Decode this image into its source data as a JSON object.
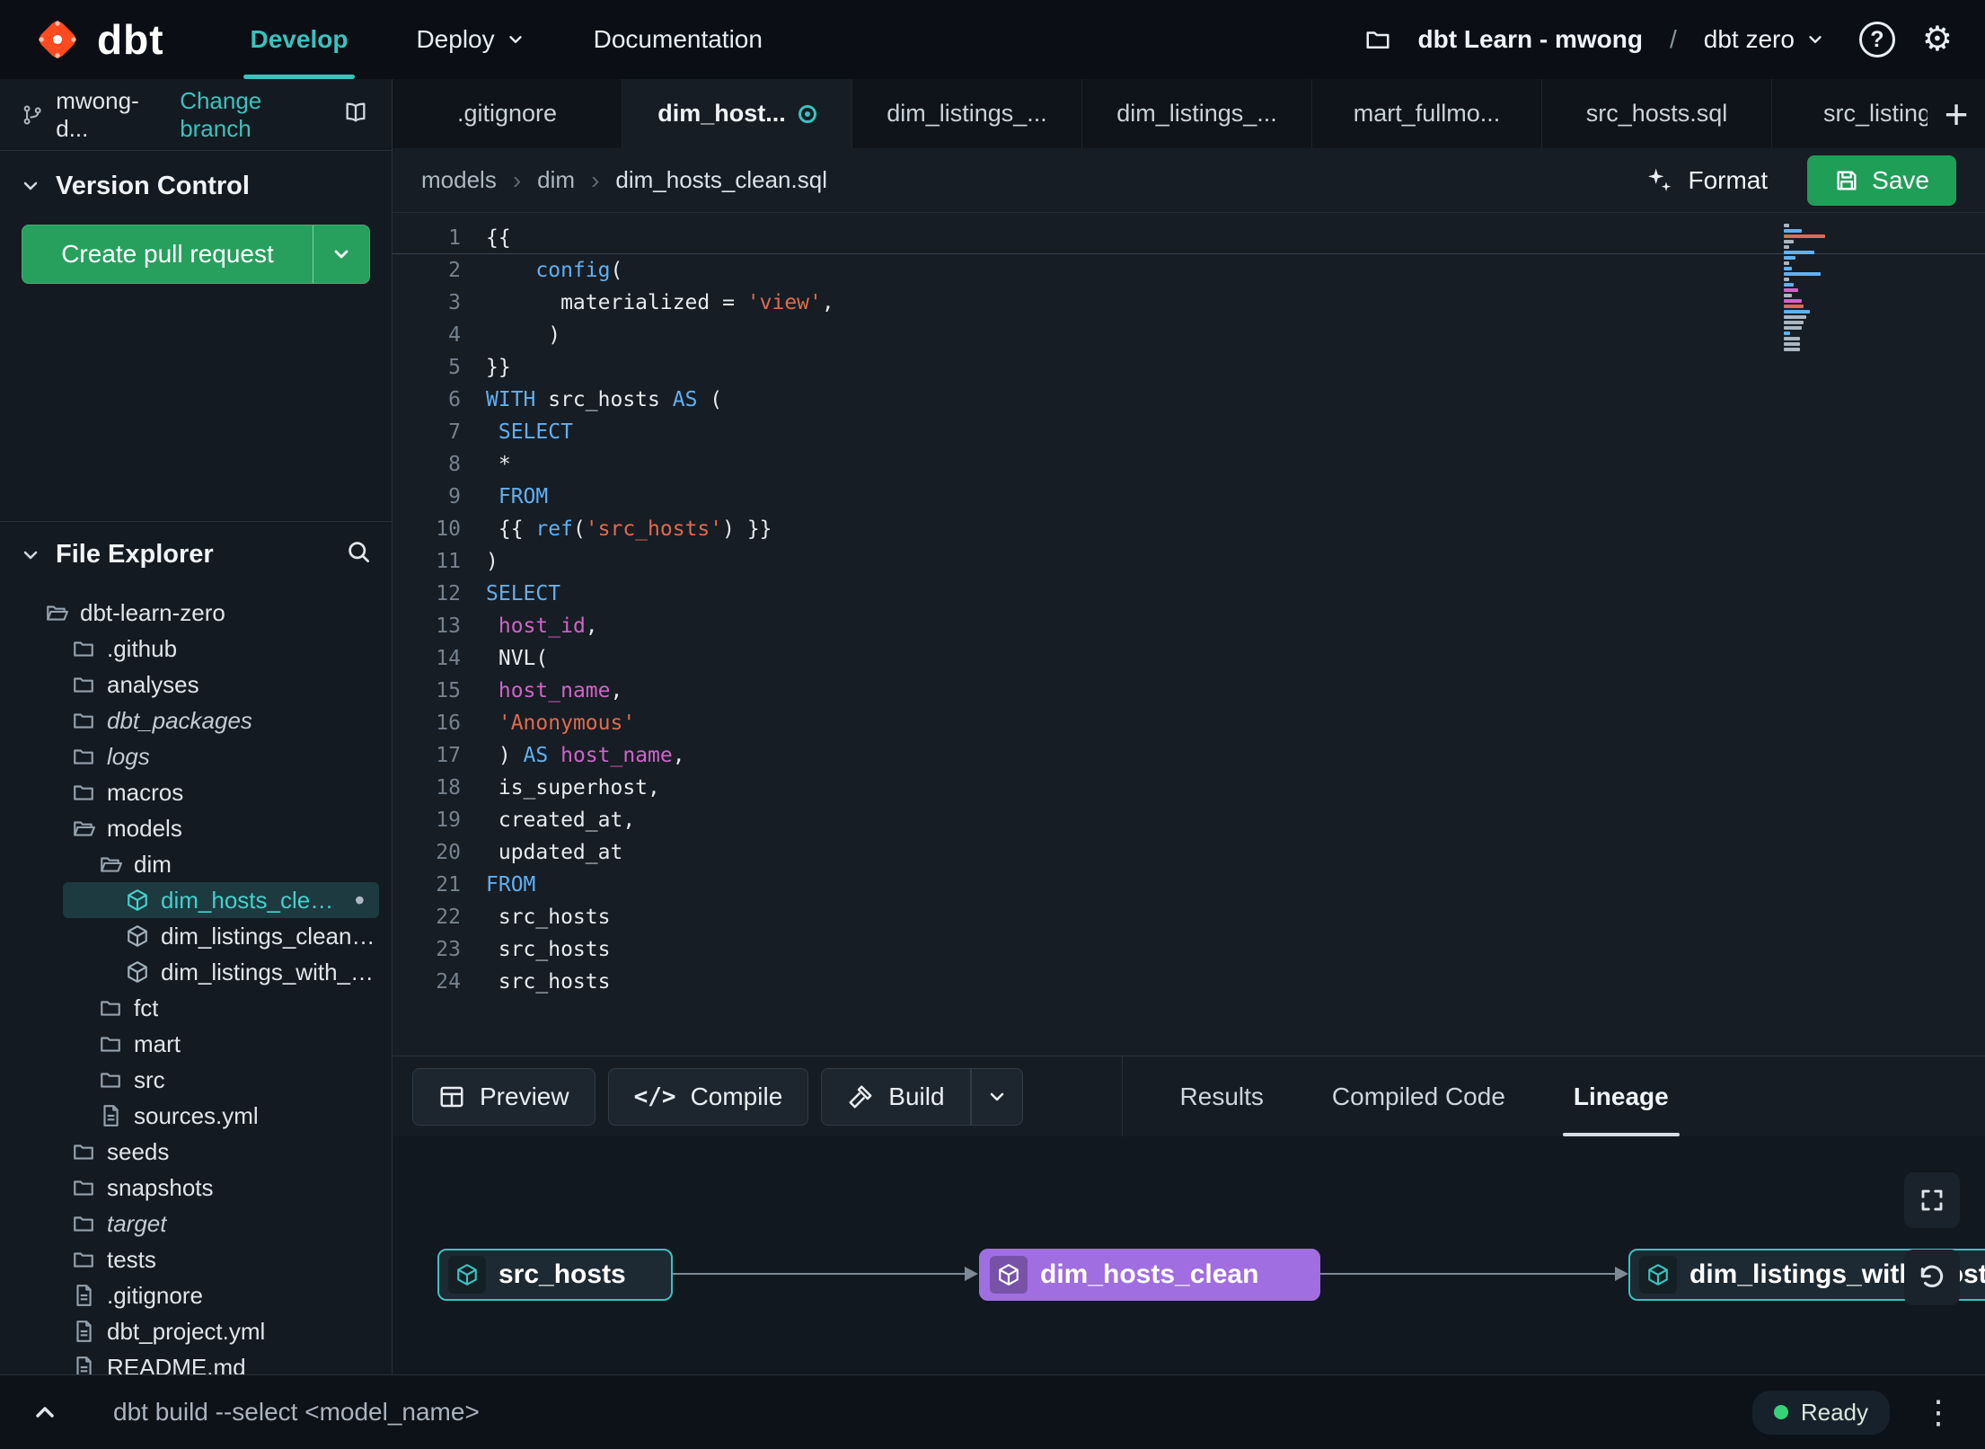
{
  "nav": {
    "brand": "dbt",
    "develop": "Develop",
    "deploy": "Deploy",
    "documentation": "Documentation",
    "project": "dbt Learn - mwong",
    "separator": "/",
    "environment": "dbt zero"
  },
  "sidebar": {
    "branch": "mwong-d...",
    "change_branch": "Change branch",
    "version_control": "Version Control",
    "create_pr": "Create pull request",
    "file_explorer": "File Explorer",
    "tree": [
      {
        "label": "dbt-learn-zero",
        "icon": "folder-open",
        "depth": 0
      },
      {
        "label": ".github",
        "icon": "folder",
        "depth": 1
      },
      {
        "label": "analyses",
        "icon": "folder",
        "depth": 1
      },
      {
        "label": "dbt_packages",
        "icon": "folder",
        "depth": 1,
        "italic": true
      },
      {
        "label": "logs",
        "icon": "folder",
        "depth": 1,
        "italic": true
      },
      {
        "label": "macros",
        "icon": "folder",
        "depth": 1
      },
      {
        "label": "models",
        "icon": "folder-open",
        "depth": 1
      },
      {
        "label": "dim",
        "icon": "folder-open",
        "depth": 2
      },
      {
        "label": "dim_hosts_clean.sql",
        "icon": "cube",
        "depth": 3,
        "selected": true,
        "modified": true
      },
      {
        "label": "dim_listings_clean.sql",
        "icon": "cube",
        "depth": 3
      },
      {
        "label": "dim_listings_with_hosts...",
        "icon": "cube",
        "depth": 3
      },
      {
        "label": "fct",
        "icon": "folder",
        "depth": 2
      },
      {
        "label": "mart",
        "icon": "folder",
        "depth": 2
      },
      {
        "label": "src",
        "icon": "folder",
        "depth": 2
      },
      {
        "label": "sources.yml",
        "icon": "file",
        "depth": 2
      },
      {
        "label": "seeds",
        "icon": "folder",
        "depth": 1
      },
      {
        "label": "snapshots",
        "icon": "folder",
        "depth": 1
      },
      {
        "label": "target",
        "icon": "folder",
        "depth": 1,
        "italic": true
      },
      {
        "label": "tests",
        "icon": "folder",
        "depth": 1
      },
      {
        "label": ".gitignore",
        "icon": "file",
        "depth": 1
      },
      {
        "label": "dbt_project.yml",
        "icon": "file",
        "depth": 1
      },
      {
        "label": "README.md",
        "icon": "file",
        "depth": 1
      }
    ]
  },
  "tabs": [
    {
      "label": ".gitignore"
    },
    {
      "label": "dim_host...",
      "active": true,
      "modified": true
    },
    {
      "label": "dim_listings_..."
    },
    {
      "label": "dim_listings_..."
    },
    {
      "label": "mart_fullmo..."
    },
    {
      "label": "src_hosts.sql"
    },
    {
      "label": "src_listings."
    }
  ],
  "breadcrumb": {
    "items": [
      "models",
      "dim",
      "dim_hosts_clean.sql"
    ]
  },
  "actions": {
    "format": "Format",
    "save": "Save"
  },
  "code": {
    "lines": [
      [
        [
          "{{",
          "p"
        ]
      ],
      [
        [
          "    ",
          "p"
        ],
        [
          "config",
          "k"
        ],
        [
          "(",
          "p"
        ]
      ],
      [
        [
          "      materialized = ",
          "p"
        ],
        [
          "'view'",
          "s"
        ],
        [
          ",",
          "p"
        ]
      ],
      [
        [
          "     )",
          "p"
        ]
      ],
      [
        [
          "}}",
          "p"
        ]
      ],
      [
        [
          "WITH",
          "k"
        ],
        [
          " src_hosts ",
          "p"
        ],
        [
          "AS",
          "k"
        ],
        [
          " (",
          "p"
        ]
      ],
      [
        [
          " ",
          "p"
        ],
        [
          "SELECT",
          "k"
        ]
      ],
      [
        [
          " *",
          "p"
        ]
      ],
      [
        [
          " ",
          "p"
        ],
        [
          "FROM",
          "k"
        ]
      ],
      [
        [
          " {{ ",
          "p"
        ],
        [
          "ref",
          "k"
        ],
        [
          "(",
          "p"
        ],
        [
          "'src_hosts'",
          "s"
        ],
        [
          ")",
          "p"
        ],
        [
          " }}",
          "p"
        ]
      ],
      [
        [
          ")",
          "p"
        ]
      ],
      [
        [
          "SELECT",
          "k"
        ]
      ],
      [
        [
          " ",
          "p"
        ],
        [
          "host_id",
          "m"
        ],
        [
          ",",
          "p"
        ]
      ],
      [
        [
          " NVL(",
          "p"
        ]
      ],
      [
        [
          " ",
          "p"
        ],
        [
          "host_name",
          "m"
        ],
        [
          ",",
          "p"
        ]
      ],
      [
        [
          " ",
          "p"
        ],
        [
          "'Anonymous'",
          "s"
        ]
      ],
      [
        [
          " ) ",
          "p"
        ],
        [
          "AS",
          "k"
        ],
        [
          " ",
          "p"
        ],
        [
          "host_name",
          "m"
        ],
        [
          ",",
          "p"
        ]
      ],
      [
        [
          " is_superhost,",
          "p"
        ]
      ],
      [
        [
          " created_at,",
          "p"
        ]
      ],
      [
        [
          " updated_at",
          "p"
        ]
      ],
      [
        [
          "FROM",
          "k"
        ]
      ],
      [
        [
          " src_hosts",
          "p"
        ]
      ],
      [
        [
          " src_hosts",
          "p"
        ]
      ],
      [
        [
          " src_hosts",
          "p"
        ]
      ]
    ]
  },
  "panel": {
    "preview": "Preview",
    "compile": "Compile",
    "build": "Build",
    "tabs": [
      {
        "label": "Results"
      },
      {
        "label": "Compiled Code"
      },
      {
        "label": "Lineage",
        "active": true
      }
    ]
  },
  "lineage": {
    "nodes": [
      {
        "label": "src_hosts",
        "variant": "teal"
      },
      {
        "label": "dim_hosts_clean",
        "variant": "purple"
      },
      {
        "label": "dim_listings_with_hosts",
        "variant": "teal"
      }
    ]
  },
  "statusbar": {
    "command": "dbt build --select <model_name>",
    "status": "Ready"
  },
  "colors": {
    "accent_teal": "#3ac2bd",
    "logo_orange": "#ff4a1f",
    "save_green": "#1f9e58",
    "pr_green": "#27a05d",
    "node_purple": "#a06ee0",
    "keyword_blue": "#61b0f1",
    "string_orange": "#e06a4f",
    "identifier_magenta": "#d163c9"
  }
}
